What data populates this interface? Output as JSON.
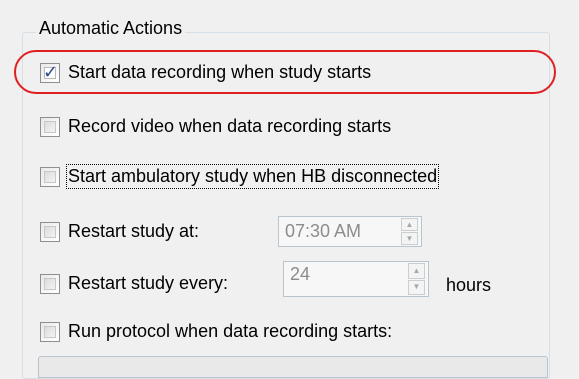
{
  "group": {
    "title": "Automatic Actions"
  },
  "options": [
    {
      "label": "Start data recording when study starts",
      "checked": true
    },
    {
      "label": "Record video when data recording starts",
      "checked": false
    },
    {
      "label": "Start ambulatory study when HB disconnected",
      "checked": false
    },
    {
      "label": "Restart study at:",
      "checked": false
    },
    {
      "label": "Restart study every:",
      "checked": false
    },
    {
      "label": "Run protocol when data recording starts:",
      "checked": false
    }
  ],
  "restart_at": {
    "value": "07:30 AM"
  },
  "restart_every": {
    "value": "24",
    "unit": "hours"
  },
  "colors": {
    "highlight": "#e02020",
    "check": "#2b4a8a"
  }
}
